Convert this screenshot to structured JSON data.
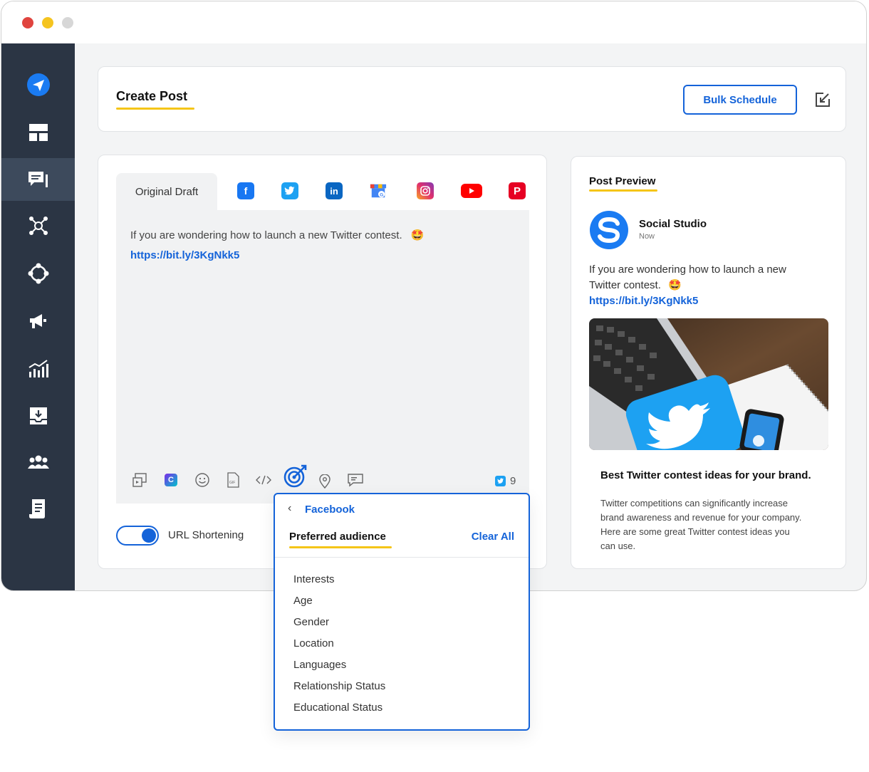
{
  "window": {
    "dots": [
      "#e0443e",
      "#f5c41f",
      "#d7d7d7"
    ]
  },
  "sidebar": {
    "items": [
      {
        "name": "send-icon",
        "active": false
      },
      {
        "name": "dashboard-icon",
        "active": false
      },
      {
        "name": "posts-icon",
        "active": true
      },
      {
        "name": "network-icon",
        "active": false
      },
      {
        "name": "engage-icon",
        "active": false
      },
      {
        "name": "megaphone-icon",
        "active": false
      },
      {
        "name": "analytics-icon",
        "active": false
      },
      {
        "name": "inbox-icon",
        "active": false
      },
      {
        "name": "team-icon",
        "active": false
      },
      {
        "name": "reports-icon",
        "active": false
      }
    ]
  },
  "header": {
    "title": "Create Post",
    "bulk_schedule": "Bulk Schedule"
  },
  "composer": {
    "tab_original": "Original Draft",
    "networks": [
      "facebook-icon",
      "twitter-icon",
      "linkedin-icon",
      "google-business-icon",
      "instagram-icon",
      "youtube-icon",
      "pinterest-icon"
    ],
    "text": "If you are wondering how to launch a new Twitter contest.",
    "emoji": "🤩",
    "link": "https://bit.ly/3KgNkk5",
    "char_count": "9",
    "url_shortening": "URL Shortening"
  },
  "audience_menu": {
    "back": "Facebook",
    "title": "Preferred audience",
    "clear_all": "Clear All",
    "options": [
      "Interests",
      "Age",
      "Gender",
      "Location",
      "Languages",
      "Relationship Status",
      "Educational Status"
    ]
  },
  "preview": {
    "title": "Post Preview",
    "account": "Social Studio",
    "time": "Now",
    "text_line1": "If you are wondering how to launch a new",
    "text_line2": "Twitter contest.",
    "emoji": "🤩",
    "link": "https://bit.ly/3KgNkk5",
    "card_title": "Best Twitter contest ideas for your brand.",
    "card_desc_lines": [
      "Twitter competitions can significantly increase",
      "brand awareness and revenue for your company.",
      "Here are some great Twitter contest ideas you",
      "can use."
    ]
  },
  "colors": {
    "accent": "#1463d9",
    "highlight": "#f5c518",
    "sidebar": "#2b3544"
  }
}
